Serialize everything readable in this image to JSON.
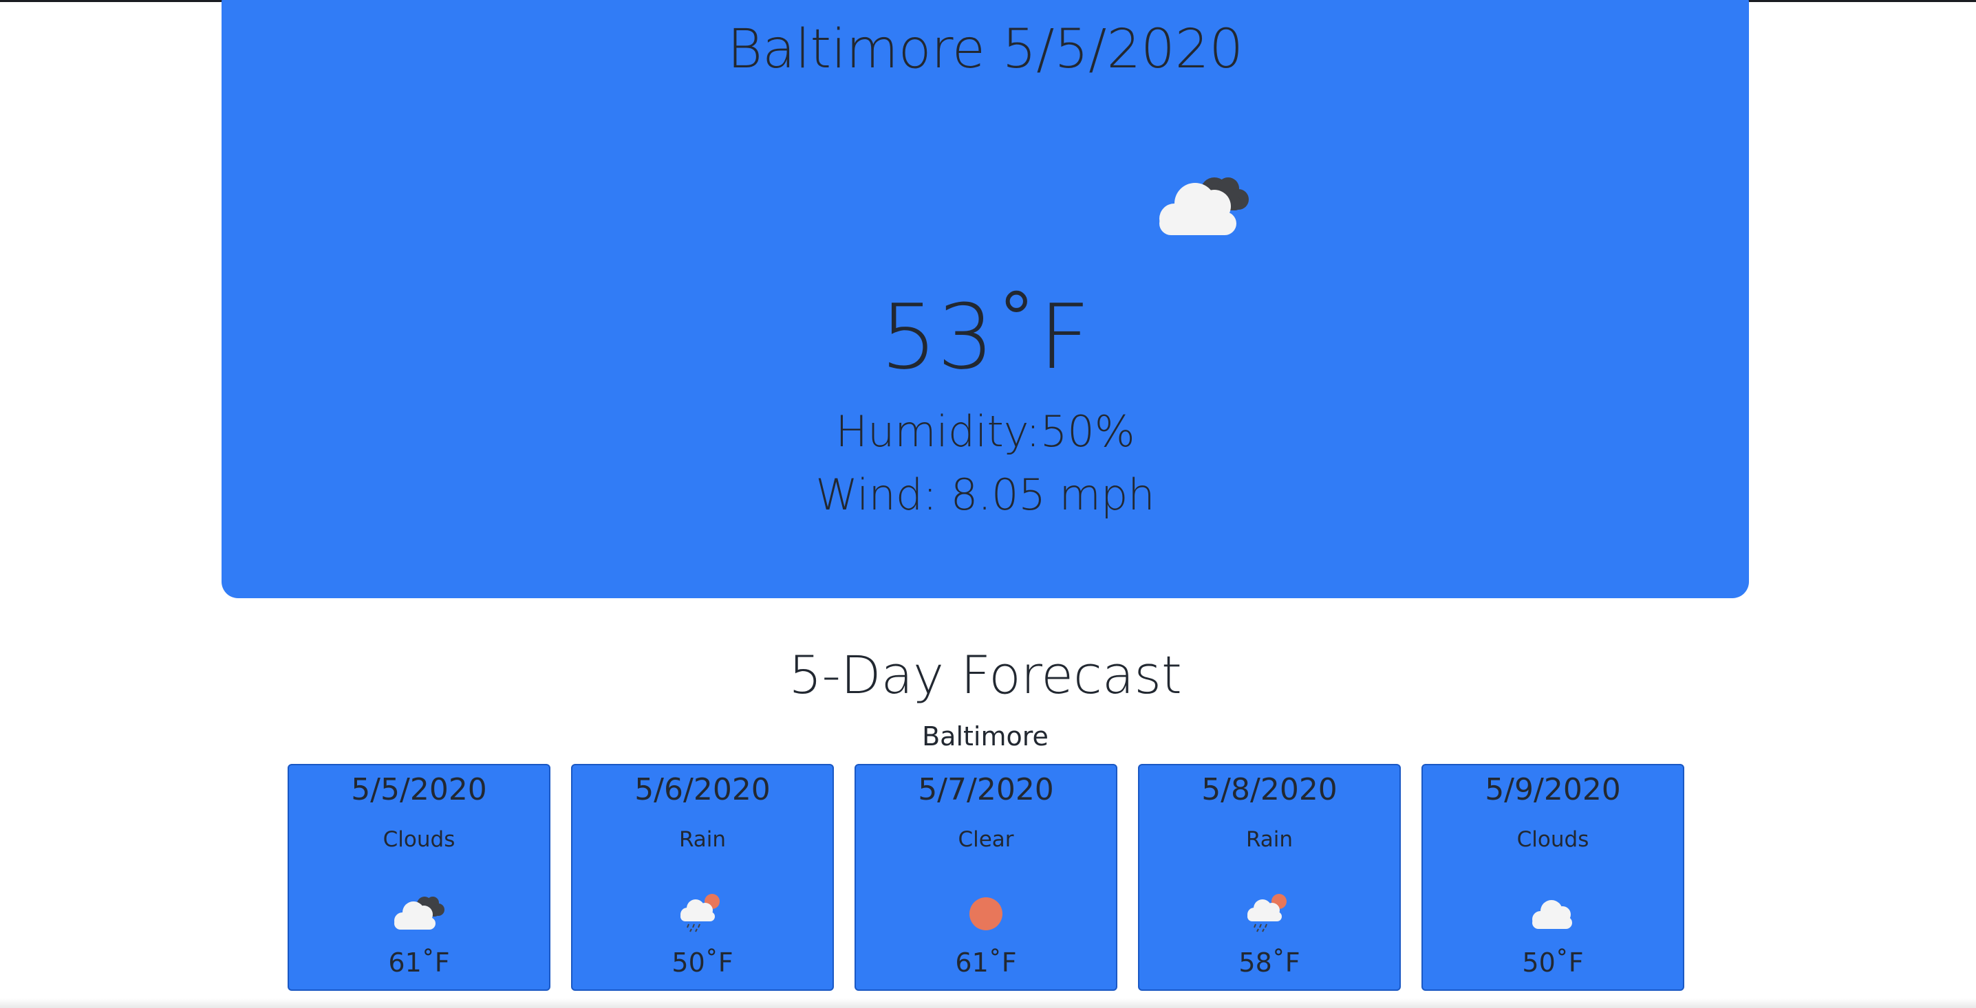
{
  "current": {
    "title": "Baltimore 5/5/2020",
    "temperature": "53˚F",
    "humidity": "Humidity:50%",
    "wind": "Wind: 8.05 mph",
    "icon": "clouds-icon"
  },
  "forecast": {
    "heading": "5-Day Forecast",
    "city": "Baltimore",
    "days": [
      {
        "date": "5/5/2020",
        "condition": "Clouds",
        "temp": "61˚F",
        "icon": "clouds-icon"
      },
      {
        "date": "5/6/2020",
        "condition": "Rain",
        "temp": "50˚F",
        "icon": "rain-icon"
      },
      {
        "date": "5/7/2020",
        "condition": "Clear",
        "temp": "61˚F",
        "icon": "clear-sun-icon"
      },
      {
        "date": "5/8/2020",
        "condition": "Rain",
        "temp": "58˚F",
        "icon": "rain-icon"
      },
      {
        "date": "5/9/2020",
        "condition": "Clouds",
        "temp": "50˚F",
        "icon": "cloud-icon"
      }
    ]
  },
  "colors": {
    "card_blue": "#317cf6",
    "card_border": "#1a58c4",
    "text": "#222831",
    "sun": "#e8775a",
    "dark_cloud": "#3f4145",
    "light_cloud": "#f4f4f4"
  }
}
